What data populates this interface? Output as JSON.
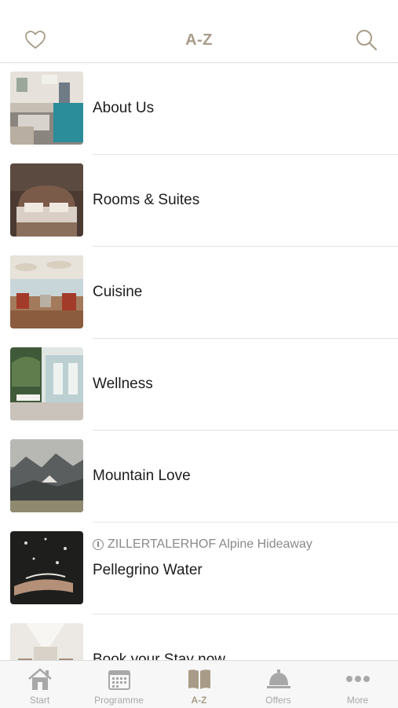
{
  "header": {
    "title": "A-Z",
    "left_icon": "heart-icon",
    "right_icon": "search-icon"
  },
  "colors": {
    "accent": "#a89c88",
    "inactive": "#a8a8a8",
    "text": "#1c1c1c"
  },
  "items": [
    {
      "label": "About Us"
    },
    {
      "label": "Rooms & Suites"
    },
    {
      "label": "Cuisine"
    },
    {
      "label": "Wellness"
    },
    {
      "label": "Mountain Love"
    },
    {
      "label": "Pellegrino Water",
      "sponsor": "ZILLERTALERHOF Alpine Hideaway"
    },
    {
      "label": "Book your Stay now"
    }
  ],
  "tabs": [
    {
      "label": "Start",
      "icon": "house-icon"
    },
    {
      "label": "Programme",
      "icon": "calendar-icon"
    },
    {
      "label": "A-Z",
      "icon": "book-icon",
      "active": true
    },
    {
      "label": "Offers",
      "icon": "service-bell-icon"
    },
    {
      "label": "More",
      "icon": "more-dots-icon"
    }
  ]
}
